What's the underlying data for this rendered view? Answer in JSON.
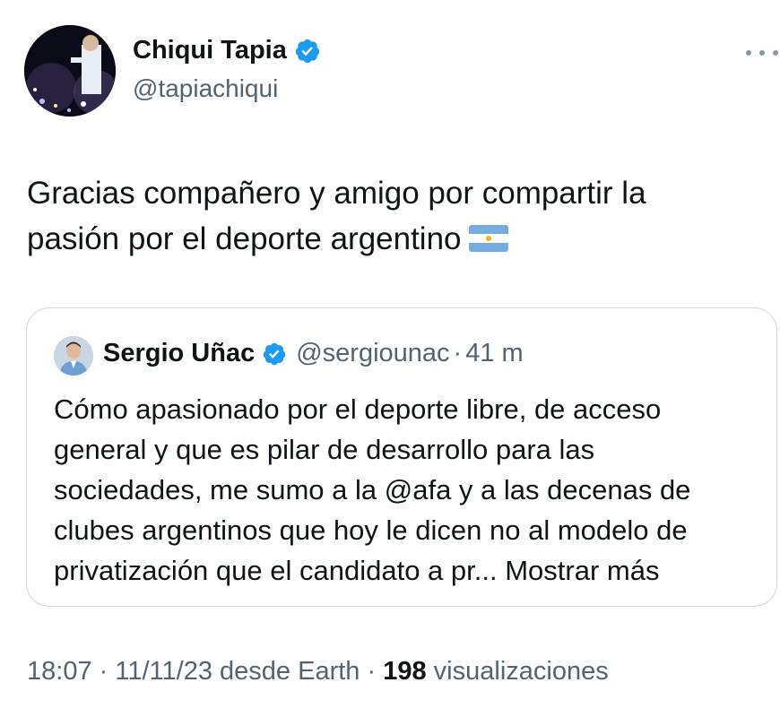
{
  "author": {
    "name": "Chiqui Tapia",
    "handle": "@tapiachiqui",
    "verified_icon": "verified-badge-icon"
  },
  "tweet": {
    "text": "Gracias compañero y amigo por compartir la pasión por el deporte argentino",
    "emoji": "argentina-flag-icon"
  },
  "quoted": {
    "name": "Sergio Uñac",
    "handle": "@sergiounac",
    "separator": "·",
    "time": "41 m",
    "text_lines": [
      "Cómo apasionado por el deporte libre, de acceso",
      "general y que es pilar de desarrollo para las",
      "sociedades, me sumo a la @afa y a las decenas de",
      "clubes argentinos que hoy le dicen no al modelo de",
      "privatización que el candidato a pr..."
    ],
    "show_more": "Mostrar más"
  },
  "meta": {
    "time": "18:07",
    "separator": "·",
    "date": "11/11/23",
    "source": "desde Earth",
    "views_count": "198",
    "views_label": "visualizaciones"
  },
  "colors": {
    "verified": "#1d9bf0",
    "secondary_text": "#536471",
    "border": "#cfd9de",
    "flag_blue": "#74acdf"
  }
}
